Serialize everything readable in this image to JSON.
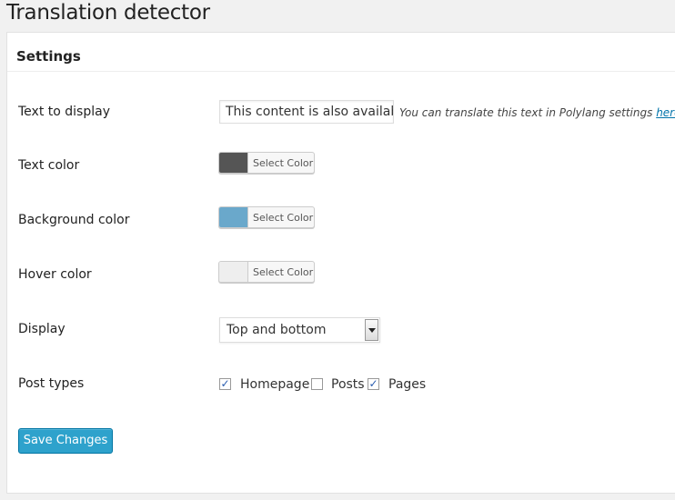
{
  "page": {
    "title": "Translation detector"
  },
  "settings": {
    "title": "Settings",
    "text_to_display": {
      "label": "Text to display",
      "value": "This content is also availab",
      "help_text": "You can translate this text in Polylang settings",
      "help_link": "here."
    },
    "text_color": {
      "label": "Text color",
      "button_label": "Select Color",
      "color": "#555555"
    },
    "background_color": {
      "label": "Background color",
      "button_label": "Select Color",
      "color": "#6aa8cb"
    },
    "hover_color": {
      "label": "Hover color",
      "button_label": "Select Color",
      "color": "#eeeeee"
    },
    "display": {
      "label": "Display",
      "selected": "Top and bottom"
    },
    "post_types": {
      "label": "Post types",
      "options": [
        {
          "label": "Homepage",
          "checked": true
        },
        {
          "label": "Posts",
          "checked": false
        },
        {
          "label": "Pages",
          "checked": true
        }
      ]
    },
    "save_label": "Save Changes"
  }
}
